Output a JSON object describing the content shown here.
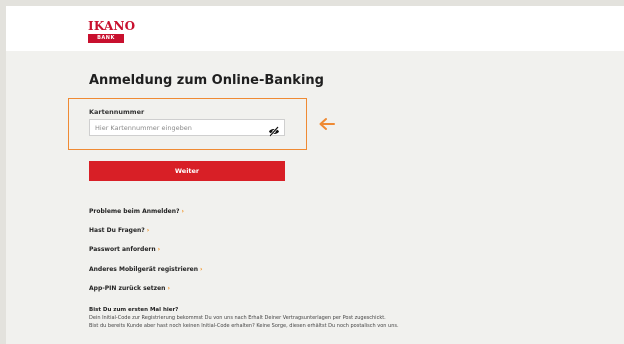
{
  "brand": {
    "name": "IKANO",
    "sub": "BANK",
    "color": "#c8102e"
  },
  "page": {
    "title": "Anmeldung zum Online-Banking"
  },
  "login": {
    "card_label": "Kartennummer",
    "card_placeholder": "Hier Kartennummer eingeben",
    "card_value": "",
    "visibility_icon": "eye-slash-icon",
    "submit_label": "Weiter"
  },
  "annotation": {
    "highlight_color": "#ef8a33",
    "arrow_icon": "arrow-left-icon"
  },
  "links": [
    {
      "label": "Probleme beim Anmelden?",
      "chevron": "›"
    },
    {
      "label": "Hast Du Fragen?",
      "chevron": "›"
    },
    {
      "label": "Passwort anfordern",
      "chevron": "›"
    },
    {
      "label": "Anderes Mobilgerät registrieren",
      "chevron": "›"
    },
    {
      "label": "App-PIN zurück setzen",
      "chevron": "›"
    }
  ],
  "info": {
    "title": "Bist Du zum ersten Mal hier?",
    "line1": "Dein Initial-Code zur Registrierung bekommst Du von uns nach Erhalt Deiner Vertragsunterlagen per Post zugeschickt.",
    "line2": "Bist du bereits Kunde aber hast noch keinen Initial-Code erhalten? Keine Sorge, diesen erhältst Du noch postalisch von uns."
  },
  "colors": {
    "accent_red": "#d81f26",
    "link_chevron": "#f29222"
  }
}
